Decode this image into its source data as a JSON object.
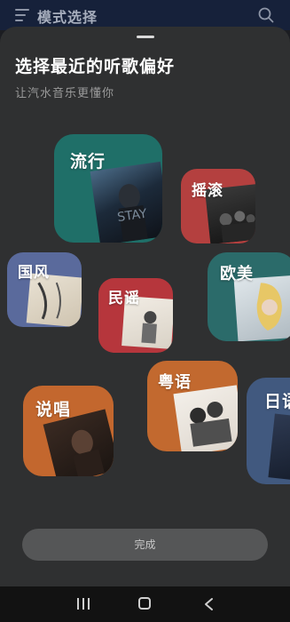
{
  "header": {
    "title": "模式选择",
    "menu_icon": "menu-icon",
    "search_icon": "search-icon"
  },
  "sheet": {
    "title": "选择最近的听歌偏好",
    "subtitle": "让汽水音乐更懂你"
  },
  "genres": [
    {
      "key": "pop",
      "label": "流行",
      "color": "#1f6f68"
    },
    {
      "key": "rock",
      "label": "摇滚",
      "color": "#b4403f"
    },
    {
      "key": "guofeng",
      "label": "国风",
      "color": "#5a6a9c"
    },
    {
      "key": "folk",
      "label": "民谣",
      "color": "#b6363c"
    },
    {
      "key": "western",
      "label": "欧美",
      "color": "#2b6b6a"
    },
    {
      "key": "rap",
      "label": "说唱",
      "color": "#c3672e"
    },
    {
      "key": "cantonese",
      "label": "粤语",
      "color": "#c2692f"
    },
    {
      "key": "japanese",
      "label": "日语",
      "color": "#41597f"
    }
  ],
  "done_button": {
    "label": "完成"
  },
  "navbar": {
    "recents_icon": "recents-icon",
    "home_icon": "home-icon",
    "back_icon": "back-icon"
  }
}
